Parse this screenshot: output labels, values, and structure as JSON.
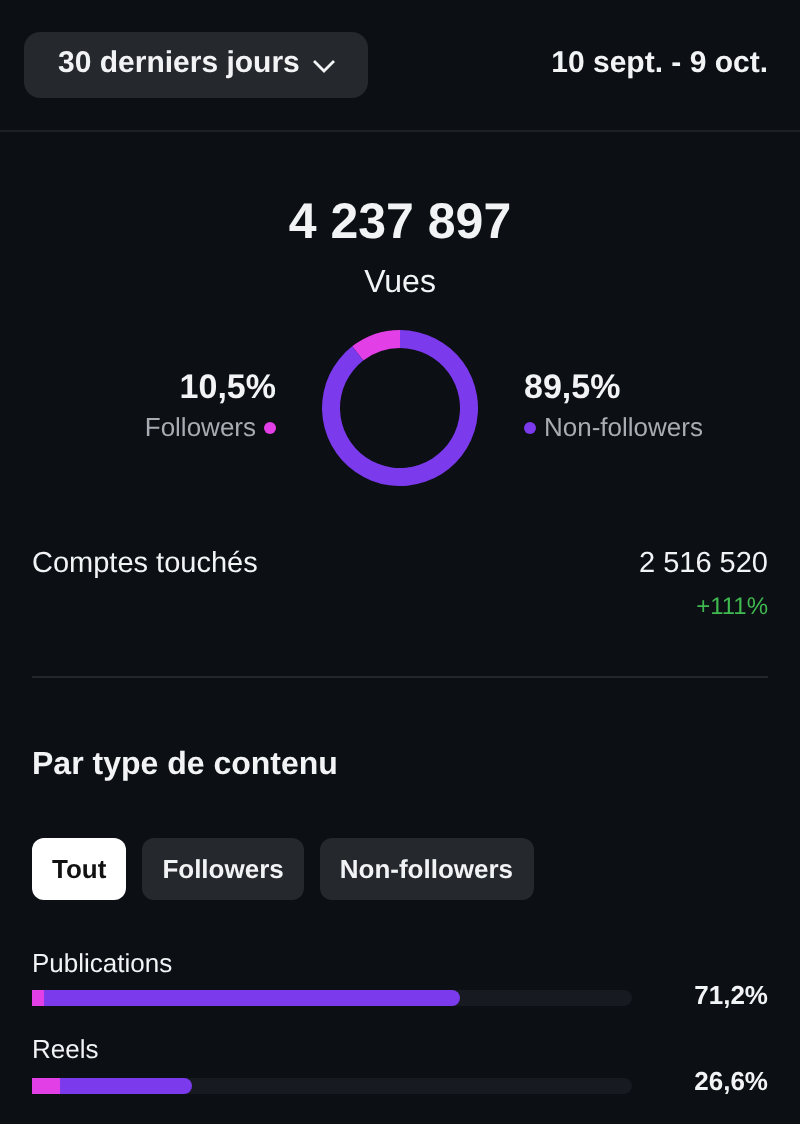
{
  "period_button": {
    "label": "30 derniers jours"
  },
  "date_range": "10 sept. - 9 oct.",
  "views": {
    "value": "4 237 897",
    "label": "Vues",
    "legend": [
      {
        "percent": "10,5%",
        "color": "#e23fe6"
      },
      {
        "percent": "89,5%",
        "color": "#7c3aed"
      }
    ],
    "chart_data": {
      "type": "donut",
      "categories": [
        "Followers",
        "Non-followers"
      ],
      "values": [
        10.5,
        89.5
      ]
    }
  },
  "accounts_reached": {
    "label": "Comptes touchés",
    "value": "2 516 520",
    "change": "+111%"
  },
  "by_content_type": {
    "title": "Par type de contenu",
    "filters": [
      {
        "label": "Tout",
        "selected": true
      },
      {
        "label": "Followers",
        "selected": false
      },
      {
        "label": "Non-followers",
        "selected": false
      }
    ],
    "rows": [
      {
        "label": "Publications",
        "percent": "71,2%",
        "level": 0.712,
        "color": "#7c3aed",
        "followers_part": {
          "level": 0.03,
          "color": "#e23fe6"
        }
      },
      {
        "label": "Reels",
        "percent": "26,6%",
        "level": 0.266,
        "color": "#7c3aed",
        "followers_part": {
          "level": 0.18,
          "color": "#e23fe6"
        }
      }
    ]
  }
}
